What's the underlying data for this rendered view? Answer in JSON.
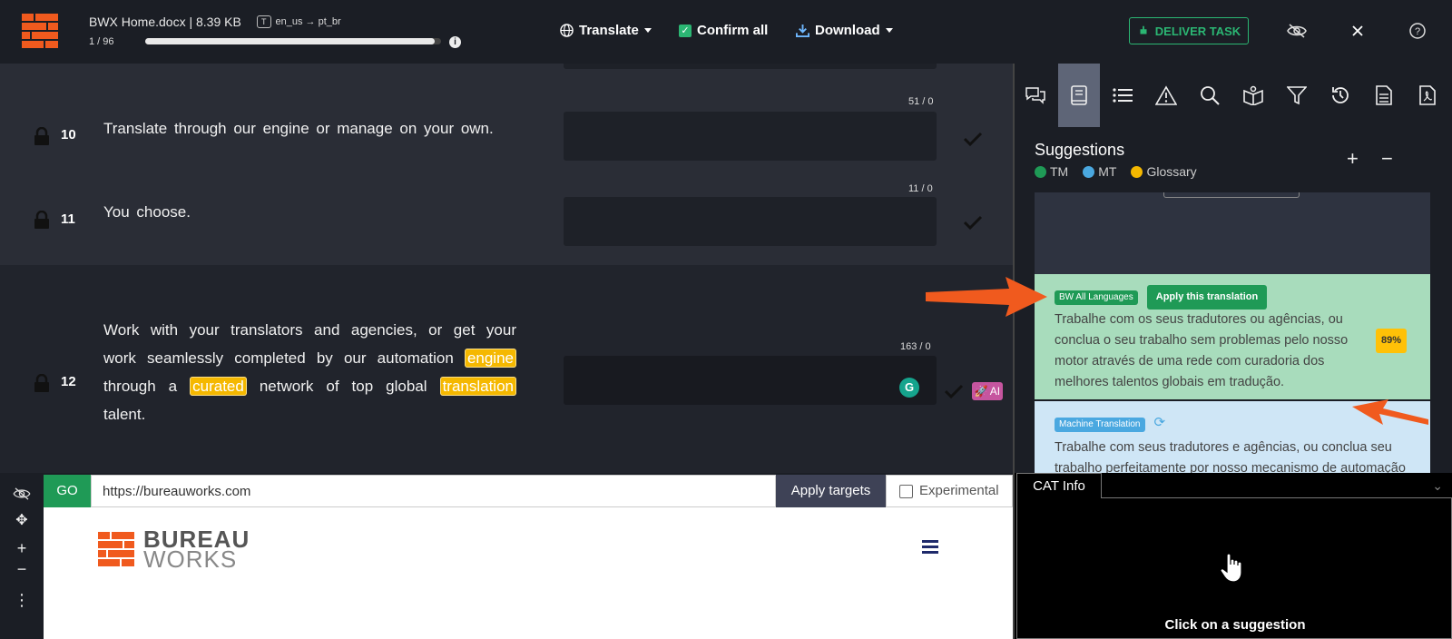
{
  "header": {
    "filename": "BWX Home.docx | 8.39 KB",
    "lang_tag": "T",
    "lang_pair": "en_us → pt_br",
    "progress_label": "1 / 96",
    "progress_fraction": 0.98,
    "translate_label": "Translate",
    "confirm_label": "Confirm all",
    "download_label": "Download",
    "deliver_label": "DELIVER TASK"
  },
  "segments": [
    {
      "number": "10",
      "source": "Translate through our engine or manage on your own.",
      "count": "51 / 0"
    },
    {
      "number": "11",
      "source": "You  choose.",
      "count": "11 / 0"
    },
    {
      "number": "12",
      "count": "163 / 0",
      "source_parts": {
        "p1": "Work with your translators and agencies, or get your work seamlessly completed by our automation ",
        "h1": "engine",
        "p2": " through a ",
        "h2": "curated",
        "p3": " network of top global ",
        "h3": "translation",
        "p4": " talent."
      },
      "grammarly": "G",
      "ai_label": "AI"
    }
  ],
  "suggestions": {
    "title": "Suggestions",
    "legend": [
      {
        "label": "TM",
        "color": "#1f9a56"
      },
      {
        "label": "MT",
        "color": "#4aa8e0"
      },
      {
        "label": "Glossary",
        "color": "#f5b800"
      }
    ],
    "plus": "+",
    "minus": "−",
    "tm_card": {
      "badge": "BW All Languages",
      "apply": "Apply this translation",
      "text": "Trabalhe com os seus tradutores ou agências, ou conclua o seu trabalho sem problemas pelo nosso motor através de uma rede com curadoria dos melhores talentos globais em tradução.",
      "match": "89%"
    },
    "mt_card": {
      "badge": "Machine Translation",
      "text": "Trabalhe com seus tradutores e agências, ou conclua seu trabalho perfeitamente por nosso mecanismo de automação por meio de uma rede com curadoria dos principais talentos globais de tradução."
    }
  },
  "browser": {
    "go_label": "GO",
    "url": "https://bureauworks.com",
    "apply_targets_label": "Apply targets",
    "experimental_label": "Experimental",
    "logo_line1": "BUREAU",
    "logo_line2": "WORKS"
  },
  "cat": {
    "tab_label": "CAT Info",
    "message": "Click on a suggestion"
  },
  "colors": {
    "accent_green": "#2bb673",
    "brand_orange": "#f05a1e",
    "highlight": "#f5b800",
    "arrow_orange": "#f05a1e"
  }
}
